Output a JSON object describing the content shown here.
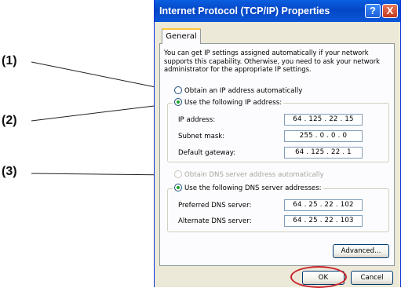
{
  "callouts": [
    "(1)",
    "(2)",
    "(3)"
  ],
  "window": {
    "title": "Internet Protocol (TCP/IP) Properties",
    "help_glyph": "?",
    "close_glyph": "X"
  },
  "tabs": [
    {
      "label": "General"
    }
  ],
  "intro_text": "You can get IP settings assigned automatically if your network supports this capability. Otherwise, you need to ask your network administrator for the appropriate IP settings.",
  "ip_mode": {
    "auto_label": "Obtain an IP address automatically",
    "manual_label": "Use the following IP address:",
    "selected": "manual"
  },
  "ip_fields": [
    {
      "label": "IP address:",
      "value": "64 . 125 . 22 . 15"
    },
    {
      "label": "Subnet mask:",
      "value": "255 . 0 . 0 . 0"
    },
    {
      "label": "Default gateway:",
      "value": "64 . 125 . 22 . 1"
    }
  ],
  "dns_mode": {
    "auto_label": "Obtain DNS server address automatically",
    "auto_disabled": true,
    "manual_label": "Use the following DNS server addresses:",
    "selected": "manual"
  },
  "dns_fields": [
    {
      "label": "Preferred DNS server:",
      "value": "64 . 25 . 22 . 102"
    },
    {
      "label": "Alternate DNS server:",
      "value": "64 . 25 . 22 . 103"
    }
  ],
  "buttons": {
    "advanced": "Advanced...",
    "ok": "OK",
    "cancel": "Cancel"
  },
  "colors": {
    "titlebar": "#0447c6",
    "highlight": "#c8232c",
    "radio_dot": "#21a121"
  }
}
